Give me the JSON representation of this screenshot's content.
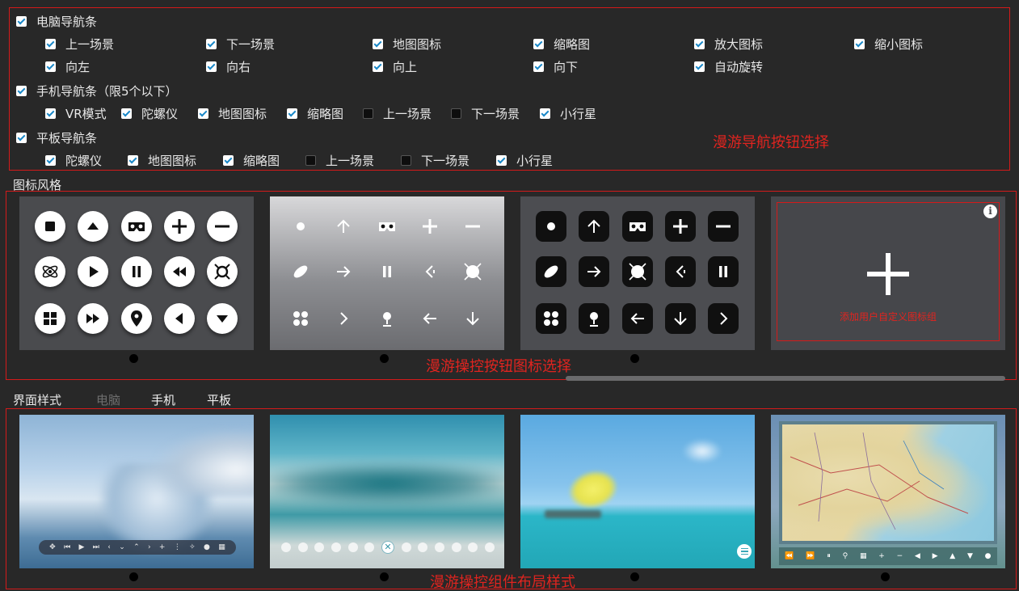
{
  "nav": {
    "pc": {
      "label": "电脑导航条",
      "row1": [
        {
          "label": "上一场景",
          "checked": true
        },
        {
          "label": "下一场景",
          "checked": true
        },
        {
          "label": "地图图标",
          "checked": true
        },
        {
          "label": "缩略图",
          "checked": true
        },
        {
          "label": "放大图标",
          "checked": true
        },
        {
          "label": "缩小图标",
          "checked": true
        }
      ],
      "row2": [
        {
          "label": "向左",
          "checked": true
        },
        {
          "label": "向右",
          "checked": true
        },
        {
          "label": "向上",
          "checked": true
        },
        {
          "label": "向下",
          "checked": true
        },
        {
          "label": "自动旋转",
          "checked": true
        }
      ]
    },
    "mobile": {
      "label": "手机导航条（限5个以下）",
      "items": [
        {
          "label": "VR模式",
          "checked": true
        },
        {
          "label": "陀螺仪",
          "checked": true
        },
        {
          "label": "地图图标",
          "checked": true
        },
        {
          "label": "缩略图",
          "checked": true
        },
        {
          "label": "上一场景",
          "checked": false
        },
        {
          "label": "下一场景",
          "checked": false
        },
        {
          "label": "小行星",
          "checked": true
        }
      ]
    },
    "tablet": {
      "label": "平板导航条",
      "items": [
        {
          "label": "陀螺仪",
          "checked": true
        },
        {
          "label": "地图图标",
          "checked": true
        },
        {
          "label": "缩略图",
          "checked": true
        },
        {
          "label": "上一场景",
          "checked": false
        },
        {
          "label": "下一场景",
          "checked": false
        },
        {
          "label": "小行星",
          "checked": true
        }
      ]
    },
    "annotation": "漫游导航按钮选择"
  },
  "icon_style": {
    "title": "图标风格",
    "annotation": "漫游操控按钮图标选择",
    "add_custom_label": "添加用户自定义图标组",
    "icons": [
      "stop-icon",
      "up-icon",
      "vr-icon",
      "plus-icon",
      "minus-icon",
      "gyro-icon",
      "play-icon",
      "pause-icon",
      "rewind-icon",
      "planet-icon",
      "grid-icon",
      "fast-forward-icon",
      "map-pin-icon",
      "left-icon",
      "down-icon"
    ]
  },
  "ui_style": {
    "title": "界面样式",
    "tabs": [
      {
        "label": "电脑",
        "active": false
      },
      {
        "label": "手机",
        "active": true
      },
      {
        "label": "平板",
        "active": true
      }
    ],
    "annotation": "漫游操控组件布局样式"
  },
  "colors": {
    "accent_red": "#e0241f",
    "background": "#282828",
    "checkbox_check": "#1a88c8"
  }
}
